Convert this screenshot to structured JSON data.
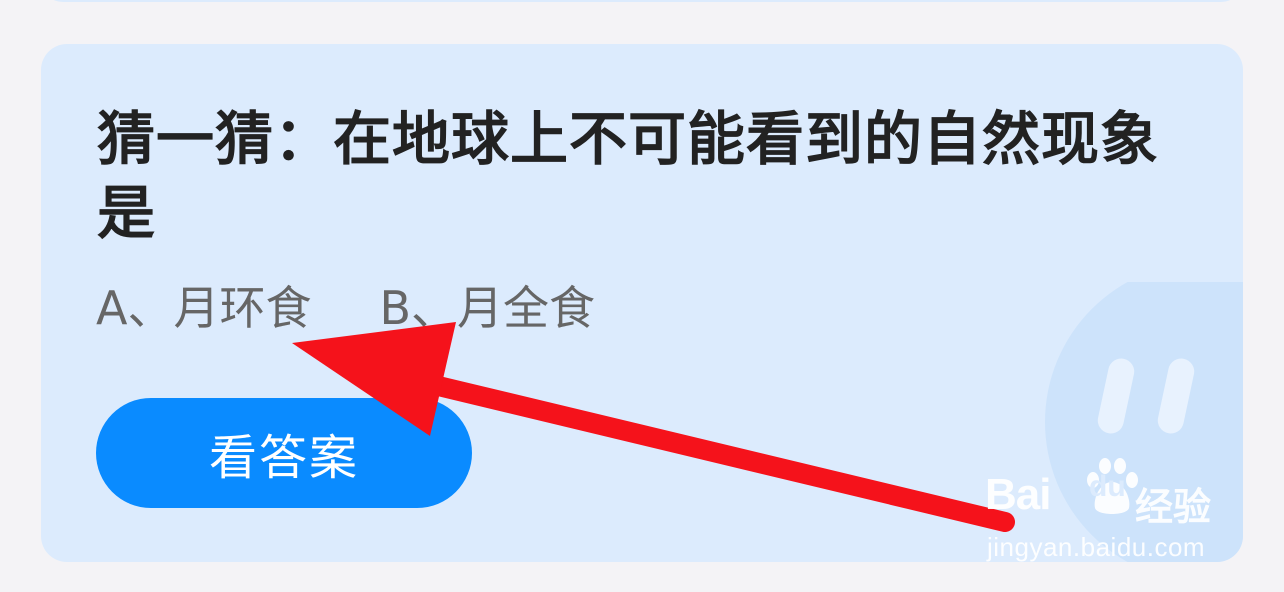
{
  "question": {
    "text": "猜一猜：在地球上不可能看到的自然现象是"
  },
  "options": {
    "a": "A、月环食",
    "b": "B、月全食"
  },
  "answer_button": {
    "label": "看答案"
  },
  "watermark": {
    "logo": "Bai",
    "paw_text": "du",
    "product": "经验",
    "url": "jingyan.baidu.com"
  },
  "colors": {
    "page_background": "#f4f3f6",
    "card_background": "#dcebfd",
    "button_blue": "#0a8bff",
    "annotation_arrow": "#f5121b"
  },
  "icons": {
    "mascot": "blob-face-mascot-icon",
    "annotation": "red-arrow-icon",
    "watermark_paw": "baidu-paw-icon"
  }
}
